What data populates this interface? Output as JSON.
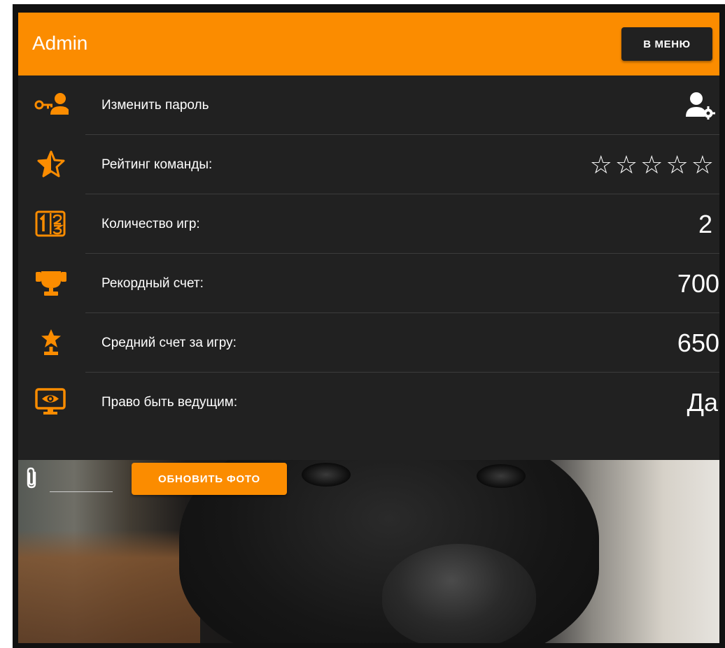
{
  "header": {
    "title": "Admin",
    "menu_button_label": "В МЕНЮ"
  },
  "rows": [
    {
      "icon": "key-user-icon",
      "label": "Изменить пароль",
      "action_icon": "user-settings-icon"
    },
    {
      "icon": "star-half-icon",
      "label": "Рейтинг команды:",
      "value": "☆☆☆☆☆",
      "rating": 0,
      "rating_max": 5
    },
    {
      "icon": "numeric-scoreboard-icon",
      "label": "Количество игр:",
      "value": "2"
    },
    {
      "icon": "trophy-icon",
      "label": "Рекордный счет:",
      "value": "700"
    },
    {
      "icon": "star-podium-icon",
      "label": "Средний счет за игру:",
      "value": "650"
    },
    {
      "icon": "monitor-eye-icon",
      "label": "Право быть ведущим:",
      "value": "Да"
    }
  ],
  "photo": {
    "attach_icon": "paperclip-icon",
    "upload_button_label": "ОБНОВИТЬ ФОТО"
  },
  "colors": {
    "accent": "#fb8c00",
    "card_background": "#212121",
    "text": "#ffffff"
  }
}
